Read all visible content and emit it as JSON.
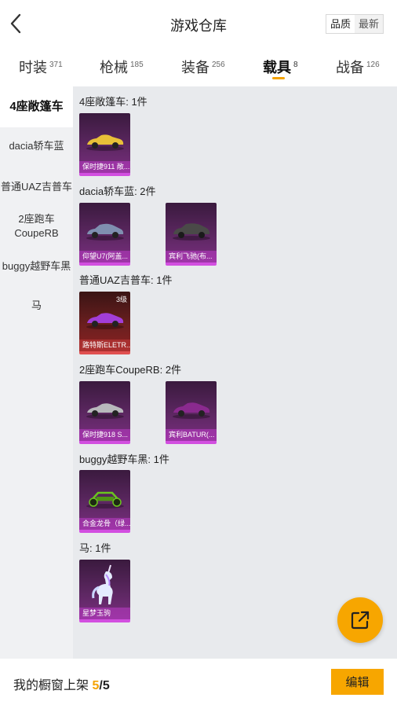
{
  "header": {
    "title": "游戏仓库",
    "sort_options": [
      "品质",
      "最新"
    ],
    "active_sort": "最新"
  },
  "tabs": [
    {
      "label": "时装",
      "count": "371"
    },
    {
      "label": "枪械",
      "count": "185"
    },
    {
      "label": "装备",
      "count": "256"
    },
    {
      "label": "载具",
      "count": "8"
    },
    {
      "label": "战备",
      "count": "126"
    }
  ],
  "active_tab": "载具",
  "sidebar": [
    {
      "label": "4座敞篷车"
    },
    {
      "label": "dacia轿车蓝"
    },
    {
      "label": "普通UAZ吉普车"
    },
    {
      "label": "2座跑车CoupeRB"
    },
    {
      "label": "buggy越野车黑"
    },
    {
      "label": "马"
    }
  ],
  "sections": [
    {
      "title": "4座敞篷车: 1件",
      "items": [
        {
          "name": "保时捷911 敞...",
          "level": ""
        }
      ]
    },
    {
      "title": "dacia轿车蓝: 2件",
      "items": [
        {
          "name": "仰望U7(阿盖...",
          "level": ""
        },
        {
          "name": "宾利飞驰(布...",
          "level": ""
        }
      ]
    },
    {
      "title": "普通UAZ吉普车: 1件",
      "items": [
        {
          "name": "路特斯ELETR...",
          "level": "3级"
        }
      ]
    },
    {
      "title": "2座跑车CoupeRB: 2件",
      "items": [
        {
          "name": "保时捷918 S...",
          "level": ""
        },
        {
          "name": "宾利BATUR(...",
          "level": ""
        }
      ]
    },
    {
      "title": "buggy越野车黑: 1件",
      "items": [
        {
          "name": "合金龙骨（绿...",
          "level": ""
        }
      ]
    },
    {
      "title": "马: 1件",
      "items": [
        {
          "name": "星梦玉驹",
          "level": ""
        }
      ]
    }
  ],
  "bottom": {
    "prefix": "我的橱窗上架 ",
    "count": "5",
    "separator": "/",
    "total": "5",
    "edit_label": "编辑"
  },
  "colors": {
    "accent": "#f7a600",
    "card_purple": "#7a2e80",
    "card_red": "#8a2222"
  },
  "icons": {
    "back": "chevron-left-icon",
    "fab": "share-external-icon"
  }
}
